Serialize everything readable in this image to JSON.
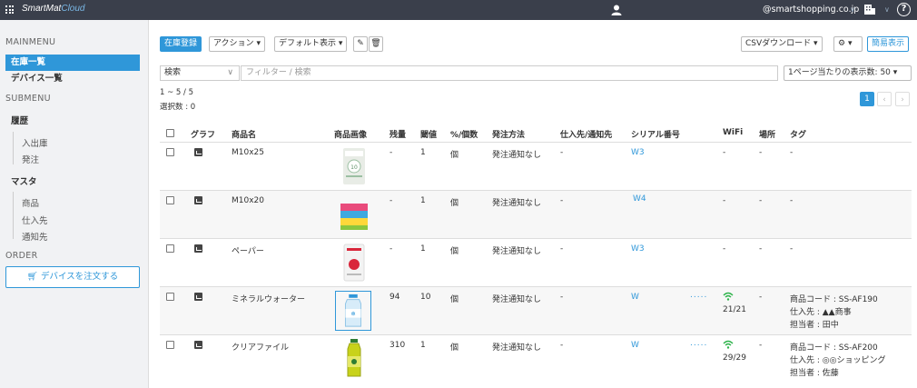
{
  "topbar": {
    "logo_main": "SmartMat",
    "logo_cloud": "Cloud",
    "account": "@smartshopping.co.jp"
  },
  "sidebar": {
    "mainmenu_label": "MAINMENU",
    "main_items": [
      "在庫一覧",
      "デバイス一覧"
    ],
    "submenu_label": "SUBMENU",
    "history_group": "履歴",
    "history_items": [
      "入出庫",
      "発注"
    ],
    "master_group": "マスタ",
    "master_items": [
      "商品",
      "仕入先",
      "通知先"
    ],
    "order_label": "ORDER",
    "order_button": "デバイスを注文する"
  },
  "toolbar": {
    "register": "在庫登録",
    "action": "アクション",
    "default_view": "デフォルト表示",
    "csv": "CSVダウンロード",
    "simple_view": "簡易表示"
  },
  "filter": {
    "search_select": "検索",
    "filter_placeholder": "フィルター / 検索",
    "per_page": "1ページ当たりの表示数: 50"
  },
  "meta": {
    "range": "1 ~ 5 / 5",
    "selected": "選択数 : 0"
  },
  "pagination": {
    "current": "1"
  },
  "table": {
    "columns": [
      "グラフ",
      "商品名",
      "商品画像",
      "残量",
      "閾値",
      "%/個数",
      "発注方法",
      "仕入先/通知先",
      "シリアル番号",
      "WiFi",
      "場所",
      "タグ"
    ],
    "rows": [
      {
        "name": "M10x25",
        "remaining": "-",
        "threshold": "1",
        "unit": "個",
        "method": "発注通知なし",
        "supplier": "-",
        "serial": "W3",
        "dots": "",
        "wifi": "-",
        "wifi_count": "",
        "place": "-",
        "tag1": "-",
        "tag2": "",
        "tag3": ""
      },
      {
        "name": "M10x20",
        "remaining": "-",
        "threshold": "1",
        "unit": "個",
        "method": "発注通知なし",
        "supplier": "-",
        "serial": "W4",
        "dots": "",
        "wifi": "-",
        "wifi_count": "",
        "place": "-",
        "tag1": "-",
        "tag2": "",
        "tag3": ""
      },
      {
        "name": "ペーパー",
        "remaining": "-",
        "threshold": "1",
        "unit": "個",
        "method": "発注通知なし",
        "supplier": "-",
        "serial": "W3",
        "dots": "",
        "wifi": "-",
        "wifi_count": "",
        "place": "-",
        "tag1": "-",
        "tag2": "",
        "tag3": ""
      },
      {
        "name": "ミネラルウォーター",
        "remaining": "94",
        "threshold": "10",
        "unit": "個",
        "method": "発注通知なし",
        "supplier": "-",
        "serial": "W",
        "dots": ".....",
        "wifi": "",
        "wifi_count": "21/21",
        "place": "-",
        "tag1": "商品コード : SS-AF190",
        "tag2": "仕入先 : ▲▲商事",
        "tag3": "担当者 : 田中"
      },
      {
        "name": "クリアファイル",
        "remaining": "310",
        "threshold": "1",
        "unit": "個",
        "method": "発注通知なし",
        "supplier": "-",
        "serial": "W",
        "dots": ".....",
        "wifi": "",
        "wifi_count": "29/29",
        "place": "-",
        "tag1": "商品コード : SS-AF200",
        "tag2": "仕入先 : ◎◎ショッピング",
        "tag3": "担当者 : 佐藤"
      }
    ]
  },
  "colors": {
    "accent": "#2f97d9",
    "topbar": "#3a3f4b",
    "wifi": "#2db34a"
  }
}
